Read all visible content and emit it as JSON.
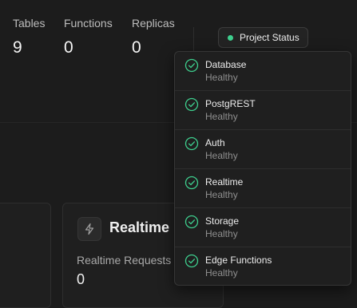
{
  "stats": [
    {
      "label": "Tables",
      "value": "9"
    },
    {
      "label": "Functions",
      "value": "0"
    },
    {
      "label": "Replicas",
      "value": "0"
    }
  ],
  "project_status": {
    "button_label": "Project Status",
    "dot_color": "#3ecf8e",
    "services": [
      {
        "name": "Database",
        "status": "Healthy",
        "icon": "check-circle-icon"
      },
      {
        "name": "PostgREST",
        "status": "Healthy",
        "icon": "check-circle-icon"
      },
      {
        "name": "Auth",
        "status": "Healthy",
        "icon": "check-circle-icon"
      },
      {
        "name": "Realtime",
        "status": "Healthy",
        "icon": "check-circle-icon"
      },
      {
        "name": "Storage",
        "status": "Healthy",
        "icon": "check-circle-icon"
      },
      {
        "name": "Edge Functions",
        "status": "Healthy",
        "icon": "check-circle-icon"
      }
    ]
  },
  "realtime_card": {
    "title": "Realtime",
    "icon": "lightning-icon",
    "metric_label": "Realtime Requests",
    "metric_value": "0"
  },
  "colors": {
    "background": "#1c1c1c",
    "healthy": "#3ecf8e",
    "muted_text": "#8f8f8f"
  }
}
